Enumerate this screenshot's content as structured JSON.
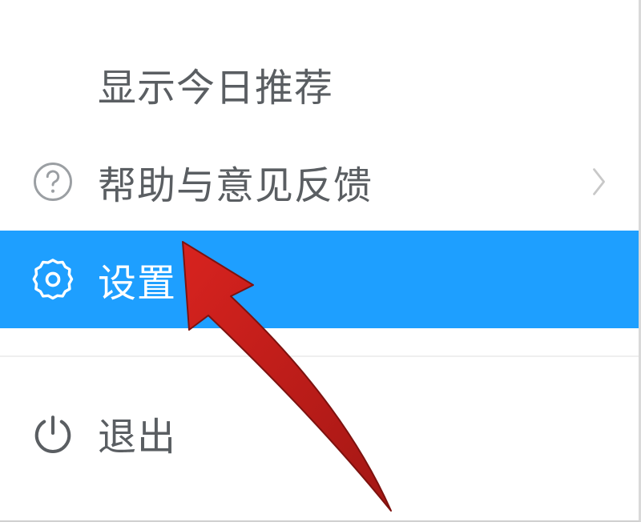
{
  "menu": {
    "items": [
      {
        "label": "显示今日推荐",
        "has_chevron": false,
        "highlighted": false
      },
      {
        "label": "帮助与意见反馈",
        "has_chevron": true,
        "highlighted": false
      },
      {
        "label": "设置",
        "has_chevron": false,
        "highlighted": true
      },
      {
        "label": "退出",
        "has_chevron": false,
        "highlighted": false
      }
    ]
  },
  "colors": {
    "highlight": "#1e9fff",
    "text": "#5a5e62",
    "text_highlight": "#ffffff",
    "arrow": "#c6201f"
  }
}
